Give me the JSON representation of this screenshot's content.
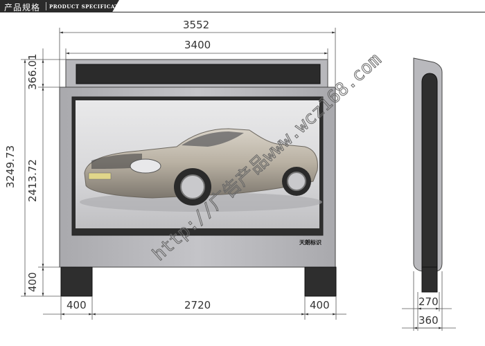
{
  "header": {
    "title_cn": "产品规格",
    "title_en": "PRODUCT SPECIFICATIONS"
  },
  "dimensions": {
    "overall_width": "3552",
    "inner_width": "3400",
    "total_height": "3249.73",
    "screen_height": "2413.72",
    "top_band_height": "366.01",
    "leg_height": "400",
    "leg_width_left": "400",
    "leg_gap": "2720",
    "leg_width_right": "400",
    "side_inner_depth": "270",
    "side_outer_depth": "360"
  },
  "panel": {
    "brand_label": "天朗标识"
  },
  "watermark": {
    "text": "http://广告产品www.wcz168.com"
  },
  "colors": {
    "frame": "#b9b9bd",
    "dark": "#2e2e2e",
    "line": "#444444",
    "header": "#2b2b2b"
  }
}
